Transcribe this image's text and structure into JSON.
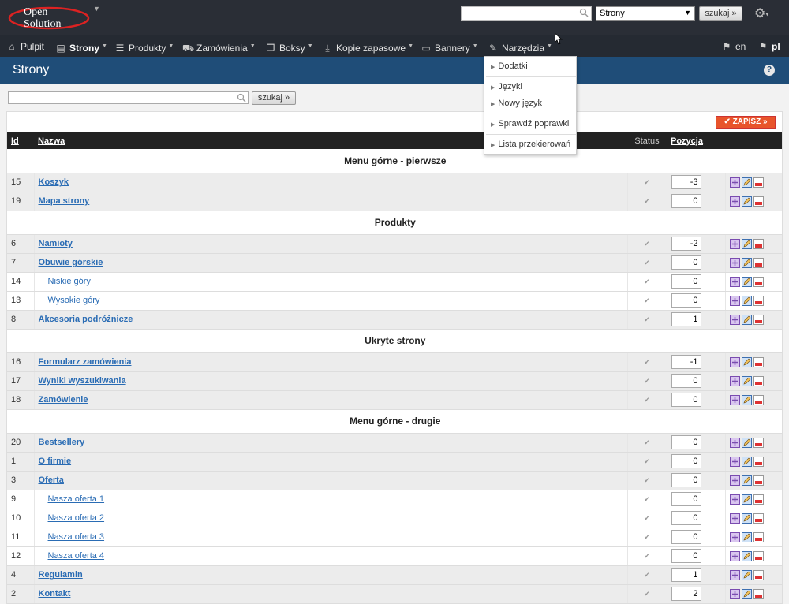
{
  "app": {
    "logo_line1": "Open",
    "logo_line2": "Solution"
  },
  "top": {
    "search_value": "",
    "select_value": "Strony",
    "search_button": "szukaj »"
  },
  "nav": {
    "items": [
      {
        "label": "Pulpit"
      },
      {
        "label": "Strony"
      },
      {
        "label": "Produkty"
      },
      {
        "label": "Zamówienia"
      },
      {
        "label": "Boksy"
      },
      {
        "label": "Kopie zapasowe"
      },
      {
        "label": "Bannery"
      },
      {
        "label": "Narzędzia"
      }
    ],
    "lang_en": "en",
    "lang_pl": "pl"
  },
  "page": {
    "title": "Strony",
    "help": "?"
  },
  "search": {
    "value": "",
    "button": "szukaj »"
  },
  "save_button": "ZAPISZ »",
  "table": {
    "headers": {
      "id": "Id",
      "name": "Nazwa",
      "status": "Status",
      "position": "Pozycja"
    },
    "sections": [
      {
        "title": "Menu górne - pierwsze",
        "rows": [
          {
            "id": "15",
            "name": "Koszyk",
            "level": 1,
            "pos": "-3"
          },
          {
            "id": "19",
            "name": "Mapa strony",
            "level": 1,
            "pos": "0"
          }
        ]
      },
      {
        "title": "Produkty",
        "rows": [
          {
            "id": "6",
            "name": "Namioty",
            "level": 1,
            "pos": "-2"
          },
          {
            "id": "7",
            "name": "Obuwie górskie",
            "level": 1,
            "pos": "0"
          },
          {
            "id": "14",
            "name": "Niskie góry",
            "level": 2,
            "pos": "0"
          },
          {
            "id": "13",
            "name": "Wysokie góry",
            "level": 2,
            "pos": "0"
          },
          {
            "id": "8",
            "name": "Akcesoria podróżnicze",
            "level": 1,
            "pos": "1"
          }
        ]
      },
      {
        "title": "Ukryte strony",
        "rows": [
          {
            "id": "16",
            "name": "Formularz zamówienia",
            "level": 1,
            "pos": "-1"
          },
          {
            "id": "17",
            "name": "Wyniki wyszukiwania",
            "level": 1,
            "pos": "0"
          },
          {
            "id": "18",
            "name": "Zamówienie",
            "level": 1,
            "pos": "0"
          }
        ]
      },
      {
        "title": "Menu górne - drugie",
        "rows": [
          {
            "id": "20",
            "name": "Bestsellery",
            "level": 1,
            "pos": "0"
          },
          {
            "id": "1",
            "name": "O firmie",
            "level": 1,
            "pos": "0"
          },
          {
            "id": "3",
            "name": "Oferta",
            "level": 1,
            "pos": "0"
          },
          {
            "id": "9",
            "name": "Nasza oferta 1",
            "level": 2,
            "pos": "0"
          },
          {
            "id": "10",
            "name": "Nasza oferta 2",
            "level": 2,
            "pos": "0"
          },
          {
            "id": "11",
            "name": "Nasza oferta 3",
            "level": 2,
            "pos": "0"
          },
          {
            "id": "12",
            "name": "Nasza oferta 4",
            "level": 2,
            "pos": "0"
          },
          {
            "id": "4",
            "name": "Regulamin",
            "level": 1,
            "pos": "1"
          },
          {
            "id": "2",
            "name": "Kontakt",
            "level": 1,
            "pos": "2"
          }
        ]
      }
    ]
  },
  "dropdown": {
    "items": [
      {
        "label": "Dodatki"
      },
      {
        "label": "Języki"
      },
      {
        "label": "Nowy język"
      },
      {
        "label": "Sprawdź poprawki"
      },
      {
        "label": "Lista przekierowań"
      }
    ]
  },
  "colors": {
    "accent": "#1f4d78",
    "save": "#e8542b",
    "link": "#2a6cb4"
  }
}
